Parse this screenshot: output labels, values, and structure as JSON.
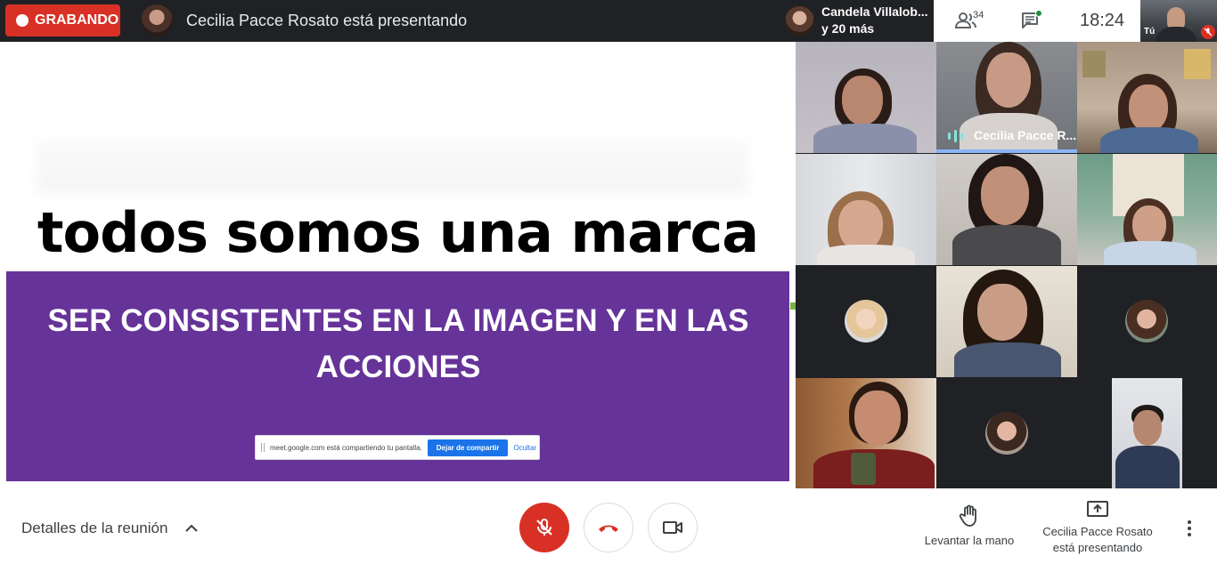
{
  "topbar": {
    "recording_label": "GRABANDO",
    "presenter_title": "Cecilia Pacce Rosato está presentando",
    "featured_participant": "Candela Villalob...",
    "more_participants": "y 20 más",
    "participants_count": "34",
    "clock": "18:24",
    "self_label": "Tú"
  },
  "slide": {
    "headline": "todos somos una marca",
    "box_text": "SER CONSISTENTES EN LA IMAGEN Y EN LAS ACCIONES",
    "share_notice": "meet.google.com está compartiendo tu pantalla.",
    "stop_sharing_label": "Dejar de compartir",
    "hide_label": "Ocultar"
  },
  "grid": {
    "speaker_name": "Cecilia Pacce R..."
  },
  "toolbar": {
    "meeting_details": "Detalles de la reunión",
    "raise_hand": "Levantar la mano",
    "presenting_line1": "Cecilia Pacce Rosato",
    "presenting_line2": "está presentando"
  },
  "colors": {
    "record_red": "#d93025",
    "slide_purple": "#663399",
    "dark_bg": "#202124",
    "share_blue": "#1a73e8"
  }
}
